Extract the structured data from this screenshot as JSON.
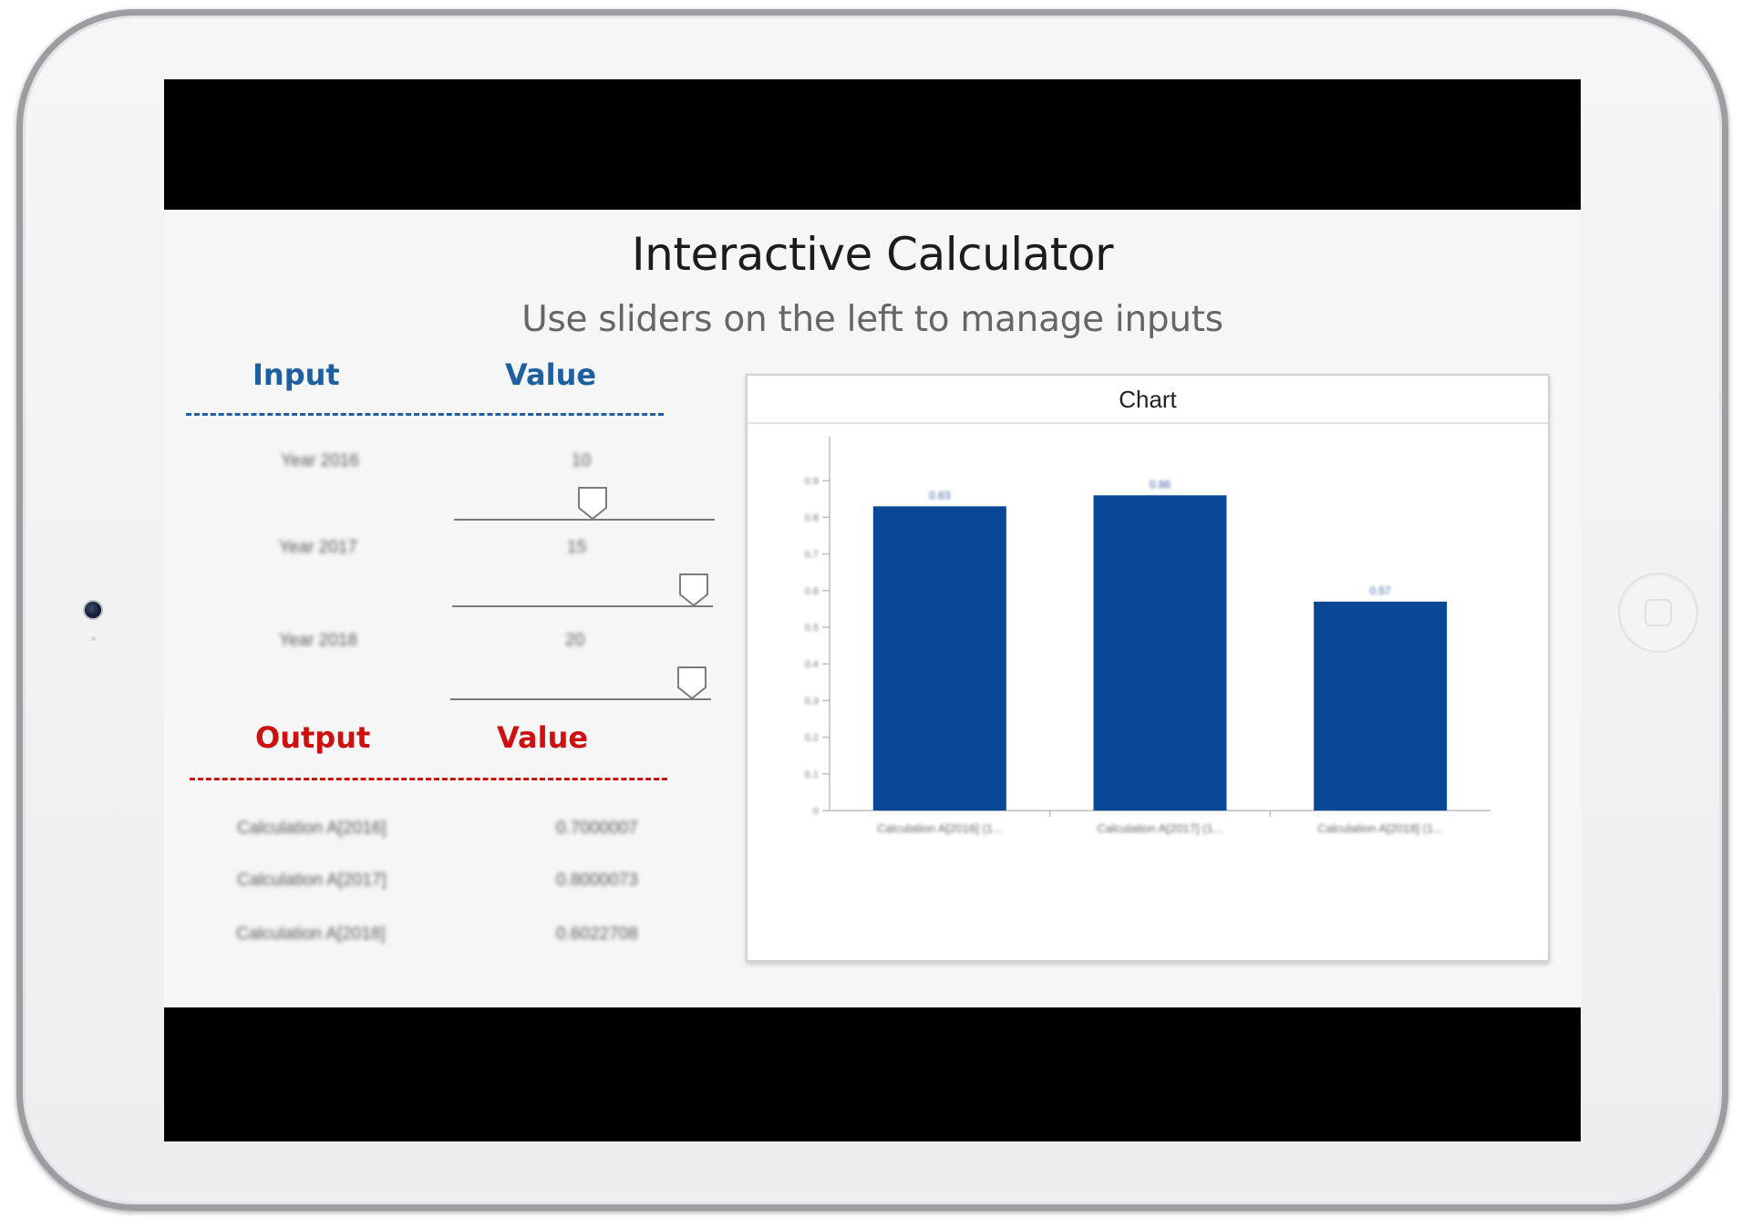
{
  "page": {
    "title": "Interactive Calculator",
    "subtitle": "Use sliders on the left to manage inputs"
  },
  "inputs": {
    "header_label": "Input",
    "header_value": "Value",
    "color": "#1d5fa0",
    "rows": [
      {
        "label": "Year 2016",
        "value": "10"
      },
      {
        "label": "Year 2017",
        "value": "15"
      },
      {
        "label": "Year 2018",
        "value": "20"
      }
    ],
    "slider_levels": [
      0.55,
      1.0,
      1.0
    ]
  },
  "outputs": {
    "header_label": "Output",
    "header_value": "Value",
    "color": "#cc1111",
    "rows": [
      {
        "label": "Calculation A[2016]",
        "value": "0.7000007"
      },
      {
        "label": "Calculation A[2017]",
        "value": "0.8000073"
      },
      {
        "label": "Calculation A[2018]",
        "value": "0.6022708"
      }
    ]
  },
  "chart_panel": {
    "title": "Chart"
  },
  "chart_data": {
    "type": "bar",
    "categories": [
      "Calculation A[2016] (1...",
      "Calculation A[2017] (1...",
      "Calculation A[2018] (1..."
    ],
    "values": [
      0.83,
      0.86,
      0.57
    ],
    "data_labels": [
      "0.83",
      "0.86",
      "0.57"
    ],
    "yticks": [
      "0",
      "0.1",
      "0.2",
      "0.3",
      "0.4",
      "0.5",
      "0.6",
      "0.7",
      "0.8",
      "0.9"
    ],
    "ylim": [
      0,
      1.0
    ],
    "bar_color": "#0a4795",
    "grid": false,
    "legend": "none"
  }
}
